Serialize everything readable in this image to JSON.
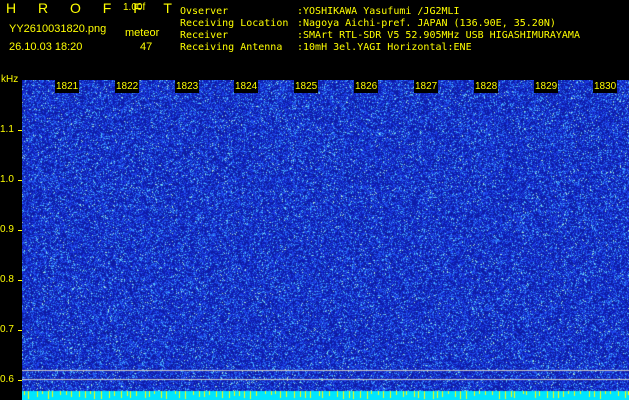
{
  "header": {
    "app_title": "H R O F F T",
    "version": "1.00f",
    "file_name": "YY2610031820.png",
    "timestamp": "26.10.03 18:20",
    "meteor_label": "meteor",
    "meteor_count": "47"
  },
  "info": {
    "observer_label": "Ovserver",
    "observer_value": ":YOSHIKAWA Yasufumi /JG2MLI",
    "location_label": "Receiving Location",
    "location_value": ":Nagoya Aichi-pref. JAPAN (136.90E, 35.20N)",
    "receiver_label": "Receiver",
    "receiver_value": ":SMArt RTL-SDR V5 52.905MHz USB HIGASHIMURAYAMA",
    "antenna_label": "Receiving Antenna",
    "antenna_value": ":10mH 3el.YAGI Horizontal:ENE"
  },
  "axes": {
    "y_unit": "kHz",
    "y_ticks": [
      "1.1",
      "1.0",
      "0.9",
      "0.8",
      "0.7",
      "0.6"
    ],
    "x_ticks": [
      "1821",
      "1822",
      "1823",
      "1824",
      "1825",
      "1826",
      "1827",
      "1828",
      "1829",
      "1830"
    ]
  },
  "colors": {
    "background": "#000000",
    "text": "#ffff00",
    "noise_base": "#1a2fd0",
    "noise_bright": "#6fd0ff",
    "baseline_band": "#00e5ff",
    "guide_line": "#c8c8c8"
  }
}
